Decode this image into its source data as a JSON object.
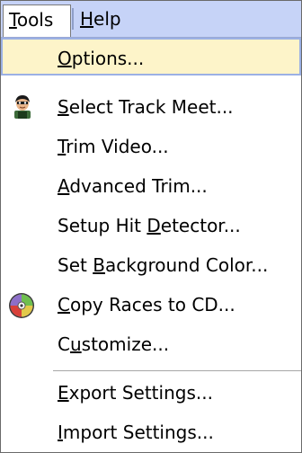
{
  "menubar": {
    "tools": {
      "pre": "",
      "mnemonic": "T",
      "post": "ools"
    },
    "help": {
      "pre": "",
      "mnemonic": "H",
      "post": "elp"
    }
  },
  "menu": {
    "items": [
      {
        "pre": "",
        "mnemonic": "O",
        "post": "ptions...",
        "highlighted": true
      },
      {
        "pre": "",
        "mnemonic": "S",
        "post": "elect Track Meet...",
        "icon": "person-icon"
      },
      {
        "pre": "",
        "mnemonic": "T",
        "post": "rim Video..."
      },
      {
        "pre": "",
        "mnemonic": "A",
        "post": "dvanced Trim..."
      },
      {
        "pre": "Setup Hit ",
        "mnemonic": "D",
        "post": "etector..."
      },
      {
        "pre": "Set ",
        "mnemonic": "B",
        "post": "ackground Color..."
      },
      {
        "pre": "",
        "mnemonic": "C",
        "post": "opy Races to CD...",
        "icon": "cd-icon"
      },
      {
        "pre": "C",
        "mnemonic": "u",
        "post": "stomize..."
      },
      {
        "pre": "",
        "mnemonic": "E",
        "post": "xport Settings..."
      },
      {
        "pre": "",
        "mnemonic": "I",
        "post": "mport Settings..."
      }
    ]
  },
  "colors": {
    "menubar_bg": "#c6d3f7",
    "highlight_bg": "#fdf4c9",
    "highlight_border": "#9bb0e4"
  }
}
